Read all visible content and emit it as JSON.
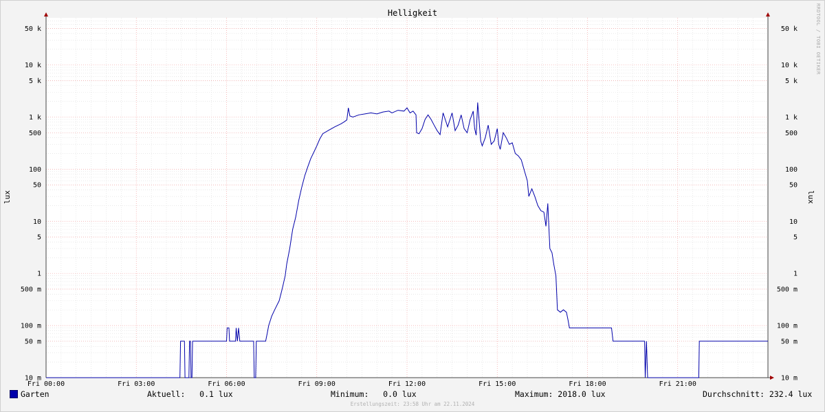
{
  "chart_data": {
    "type": "line",
    "title": "Helligkeit",
    "ylabel": "lux",
    "y_scale": "log",
    "ylim": [
      0.01,
      80000
    ],
    "xlim_hours": [
      0,
      24
    ],
    "x_ticks": [
      "Fri 00:00",
      "Fri 03:00",
      "Fri 06:00",
      "Fri 09:00",
      "Fri 12:00",
      "Fri 15:00",
      "Fri 18:00",
      "Fri 21:00"
    ],
    "y_ticks": [
      {
        "value": 50000,
        "label": "50 k"
      },
      {
        "value": 10000,
        "label": "10 k"
      },
      {
        "value": 5000,
        "label": "5 k"
      },
      {
        "value": 1000,
        "label": "1 k"
      },
      {
        "value": 500,
        "label": "500"
      },
      {
        "value": 100,
        "label": "100"
      },
      {
        "value": 50,
        "label": "50"
      },
      {
        "value": 10,
        "label": "10"
      },
      {
        "value": 5,
        "label": "5"
      },
      {
        "value": 1,
        "label": "1"
      },
      {
        "value": 0.5,
        "label": "500 m"
      },
      {
        "value": 0.1,
        "label": "100 m"
      },
      {
        "value": 0.05,
        "label": "50 m"
      },
      {
        "value": 0.01,
        "label": "10 m"
      }
    ],
    "grid": true,
    "series": [
      {
        "name": "Garten",
        "color": "#0000aa",
        "points": [
          [
            0,
            0.01
          ],
          [
            4.45,
            0.01
          ],
          [
            4.47,
            0.05
          ],
          [
            4.6,
            0.05
          ],
          [
            4.62,
            0.01
          ],
          [
            4.75,
            0.01
          ],
          [
            4.77,
            0.05
          ],
          [
            4.8,
            0.05
          ],
          [
            4.82,
            0.01
          ],
          [
            4.85,
            0.01
          ],
          [
            4.87,
            0.05
          ],
          [
            6.0,
            0.05
          ],
          [
            6.02,
            0.09
          ],
          [
            6.08,
            0.09
          ],
          [
            6.1,
            0.05
          ],
          [
            6.3,
            0.05
          ],
          [
            6.32,
            0.09
          ],
          [
            6.36,
            0.05
          ],
          [
            6.4,
            0.09
          ],
          [
            6.44,
            0.05
          ],
          [
            6.9,
            0.05
          ],
          [
            6.92,
            0.01
          ],
          [
            6.97,
            0.01
          ],
          [
            6.99,
            0.05
          ],
          [
            7.3,
            0.05
          ],
          [
            7.35,
            0.07
          ],
          [
            7.4,
            0.1
          ],
          [
            7.5,
            0.15
          ],
          [
            7.6,
            0.2
          ],
          [
            7.75,
            0.3
          ],
          [
            7.85,
            0.5
          ],
          [
            7.95,
            0.9
          ],
          [
            8.0,
            1.5
          ],
          [
            8.1,
            3
          ],
          [
            8.2,
            7
          ],
          [
            8.3,
            12
          ],
          [
            8.4,
            25
          ],
          [
            8.5,
            45
          ],
          [
            8.6,
            75
          ],
          [
            8.7,
            110
          ],
          [
            8.8,
            160
          ],
          [
            8.9,
            210
          ],
          [
            9.0,
            280
          ],
          [
            9.1,
            380
          ],
          [
            9.2,
            480
          ],
          [
            9.4,
            560
          ],
          [
            9.6,
            650
          ],
          [
            9.8,
            740
          ],
          [
            9.9,
            800
          ],
          [
            10.0,
            880
          ],
          [
            10.05,
            1500
          ],
          [
            10.1,
            1050
          ],
          [
            10.2,
            1000
          ],
          [
            10.4,
            1100
          ],
          [
            10.6,
            1150
          ],
          [
            10.8,
            1200
          ],
          [
            11.0,
            1150
          ],
          [
            11.2,
            1250
          ],
          [
            11.4,
            1300
          ],
          [
            11.5,
            1200
          ],
          [
            11.7,
            1350
          ],
          [
            11.9,
            1300
          ],
          [
            12.0,
            1500
          ],
          [
            12.1,
            1200
          ],
          [
            12.2,
            1300
          ],
          [
            12.3,
            1100
          ],
          [
            12.32,
            500
          ],
          [
            12.4,
            480
          ],
          [
            12.5,
            600
          ],
          [
            12.6,
            900
          ],
          [
            12.7,
            1100
          ],
          [
            12.8,
            900
          ],
          [
            12.9,
            700
          ],
          [
            13.0,
            550
          ],
          [
            13.1,
            460
          ],
          [
            13.2,
            1200
          ],
          [
            13.35,
            650
          ],
          [
            13.5,
            1200
          ],
          [
            13.6,
            550
          ],
          [
            13.7,
            700
          ],
          [
            13.8,
            1100
          ],
          [
            13.9,
            600
          ],
          [
            14.0,
            500
          ],
          [
            14.1,
            900
          ],
          [
            14.2,
            1300
          ],
          [
            14.25,
            600
          ],
          [
            14.3,
            450
          ],
          [
            14.35,
            1900
          ],
          [
            14.45,
            350
          ],
          [
            14.5,
            280
          ],
          [
            14.6,
            400
          ],
          [
            14.7,
            700
          ],
          [
            14.8,
            300
          ],
          [
            14.9,
            350
          ],
          [
            15.0,
            600
          ],
          [
            15.05,
            300
          ],
          [
            15.1,
            240
          ],
          [
            15.2,
            500
          ],
          [
            15.3,
            400
          ],
          [
            15.4,
            300
          ],
          [
            15.5,
            320
          ],
          [
            15.6,
            200
          ],
          [
            15.7,
            180
          ],
          [
            15.8,
            150
          ],
          [
            15.9,
            95
          ],
          [
            16.0,
            60
          ],
          [
            16.05,
            30
          ],
          [
            16.15,
            42
          ],
          [
            16.25,
            30
          ],
          [
            16.35,
            20
          ],
          [
            16.45,
            16
          ],
          [
            16.55,
            15
          ],
          [
            16.62,
            8
          ],
          [
            16.68,
            22
          ],
          [
            16.75,
            3
          ],
          [
            16.82,
            2.5
          ],
          [
            16.88,
            1.5
          ],
          [
            16.95,
            0.9
          ],
          [
            17.0,
            0.2
          ],
          [
            17.1,
            0.18
          ],
          [
            17.2,
            0.2
          ],
          [
            17.3,
            0.18
          ],
          [
            17.35,
            0.13
          ],
          [
            17.4,
            0.09
          ],
          [
            18.8,
            0.09
          ],
          [
            18.85,
            0.05
          ],
          [
            19.9,
            0.05
          ],
          [
            19.92,
            0.01
          ],
          [
            19.96,
            0.05
          ],
          [
            20.0,
            0.01
          ],
          [
            21.7,
            0.01
          ],
          [
            21.72,
            0.05
          ],
          [
            24.0,
            0.05
          ]
        ]
      }
    ]
  },
  "legend": {
    "series_name": "Garten",
    "aktuell": "Aktuell:   0.1 lux",
    "minimum": "Minimum:   0.0 lux",
    "maximum": "Maximum: 2018.0 lux",
    "durchschnitt": "Durchschnitt: 232.4 lux"
  },
  "footer": "Erstellungszeit: 23:58 Uhr am 22.11.2024",
  "watermark": "RRDTOOL / TOBI OETIKER"
}
